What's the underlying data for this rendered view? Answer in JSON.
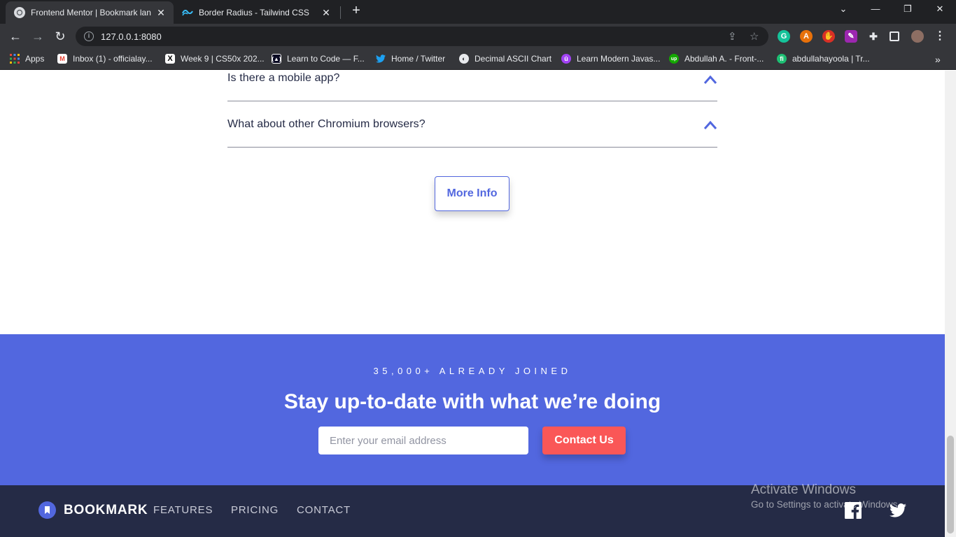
{
  "browser": {
    "tabs": [
      {
        "title": "Frontend Mentor | Bookmark lan",
        "active": true
      },
      {
        "title": "Border Radius - Tailwind CSS",
        "active": false
      }
    ],
    "new_tab_label": "+",
    "url": "127.0.0.1:8080",
    "bookmarks": [
      {
        "label": "Apps",
        "icon": "apps-grid-icon"
      },
      {
        "label": "Inbox (1) - officialay...",
        "icon": "gmail-icon"
      },
      {
        "label": "Week 9 | CS50x 202...",
        "icon": "x-icon"
      },
      {
        "label": "Learn to Code — F...",
        "icon": "freecodecamp-icon"
      },
      {
        "label": "Home / Twitter",
        "icon": "twitter-icon"
      },
      {
        "label": "Decimal ASCII Chart",
        "icon": "globe-icon"
      },
      {
        "label": "Learn Modern Javas...",
        "icon": "javascript-icon"
      },
      {
        "label": "Abdullah A. - Front-...",
        "icon": "upwork-icon"
      },
      {
        "label": "abdullahayoola | Tr...",
        "icon": "fiverr-icon"
      }
    ],
    "bookmarks_overflow": "»"
  },
  "faq": {
    "items": [
      {
        "question": "Is there a mobile app?"
      },
      {
        "question": "What about other Chromium browsers?"
      }
    ],
    "more_info_label": "More Info"
  },
  "cta": {
    "kicker": "35,000+ ALREADY JOINED",
    "title": "Stay up-to-date with what we’re doing",
    "email_placeholder": "Enter your email address",
    "button_label": "Contact Us"
  },
  "footer": {
    "logo_text": "BOOKMARK",
    "links": [
      "FEATURES",
      "PRICING",
      "CONTACT"
    ]
  },
  "watermark": {
    "title": "Activate Windows",
    "subtitle": "Go to Settings to activate Windows."
  },
  "colors": {
    "primary": "#5267df",
    "accent_red": "#fa5757",
    "footer_bg": "#252b46",
    "text_dark": "#242a45"
  }
}
